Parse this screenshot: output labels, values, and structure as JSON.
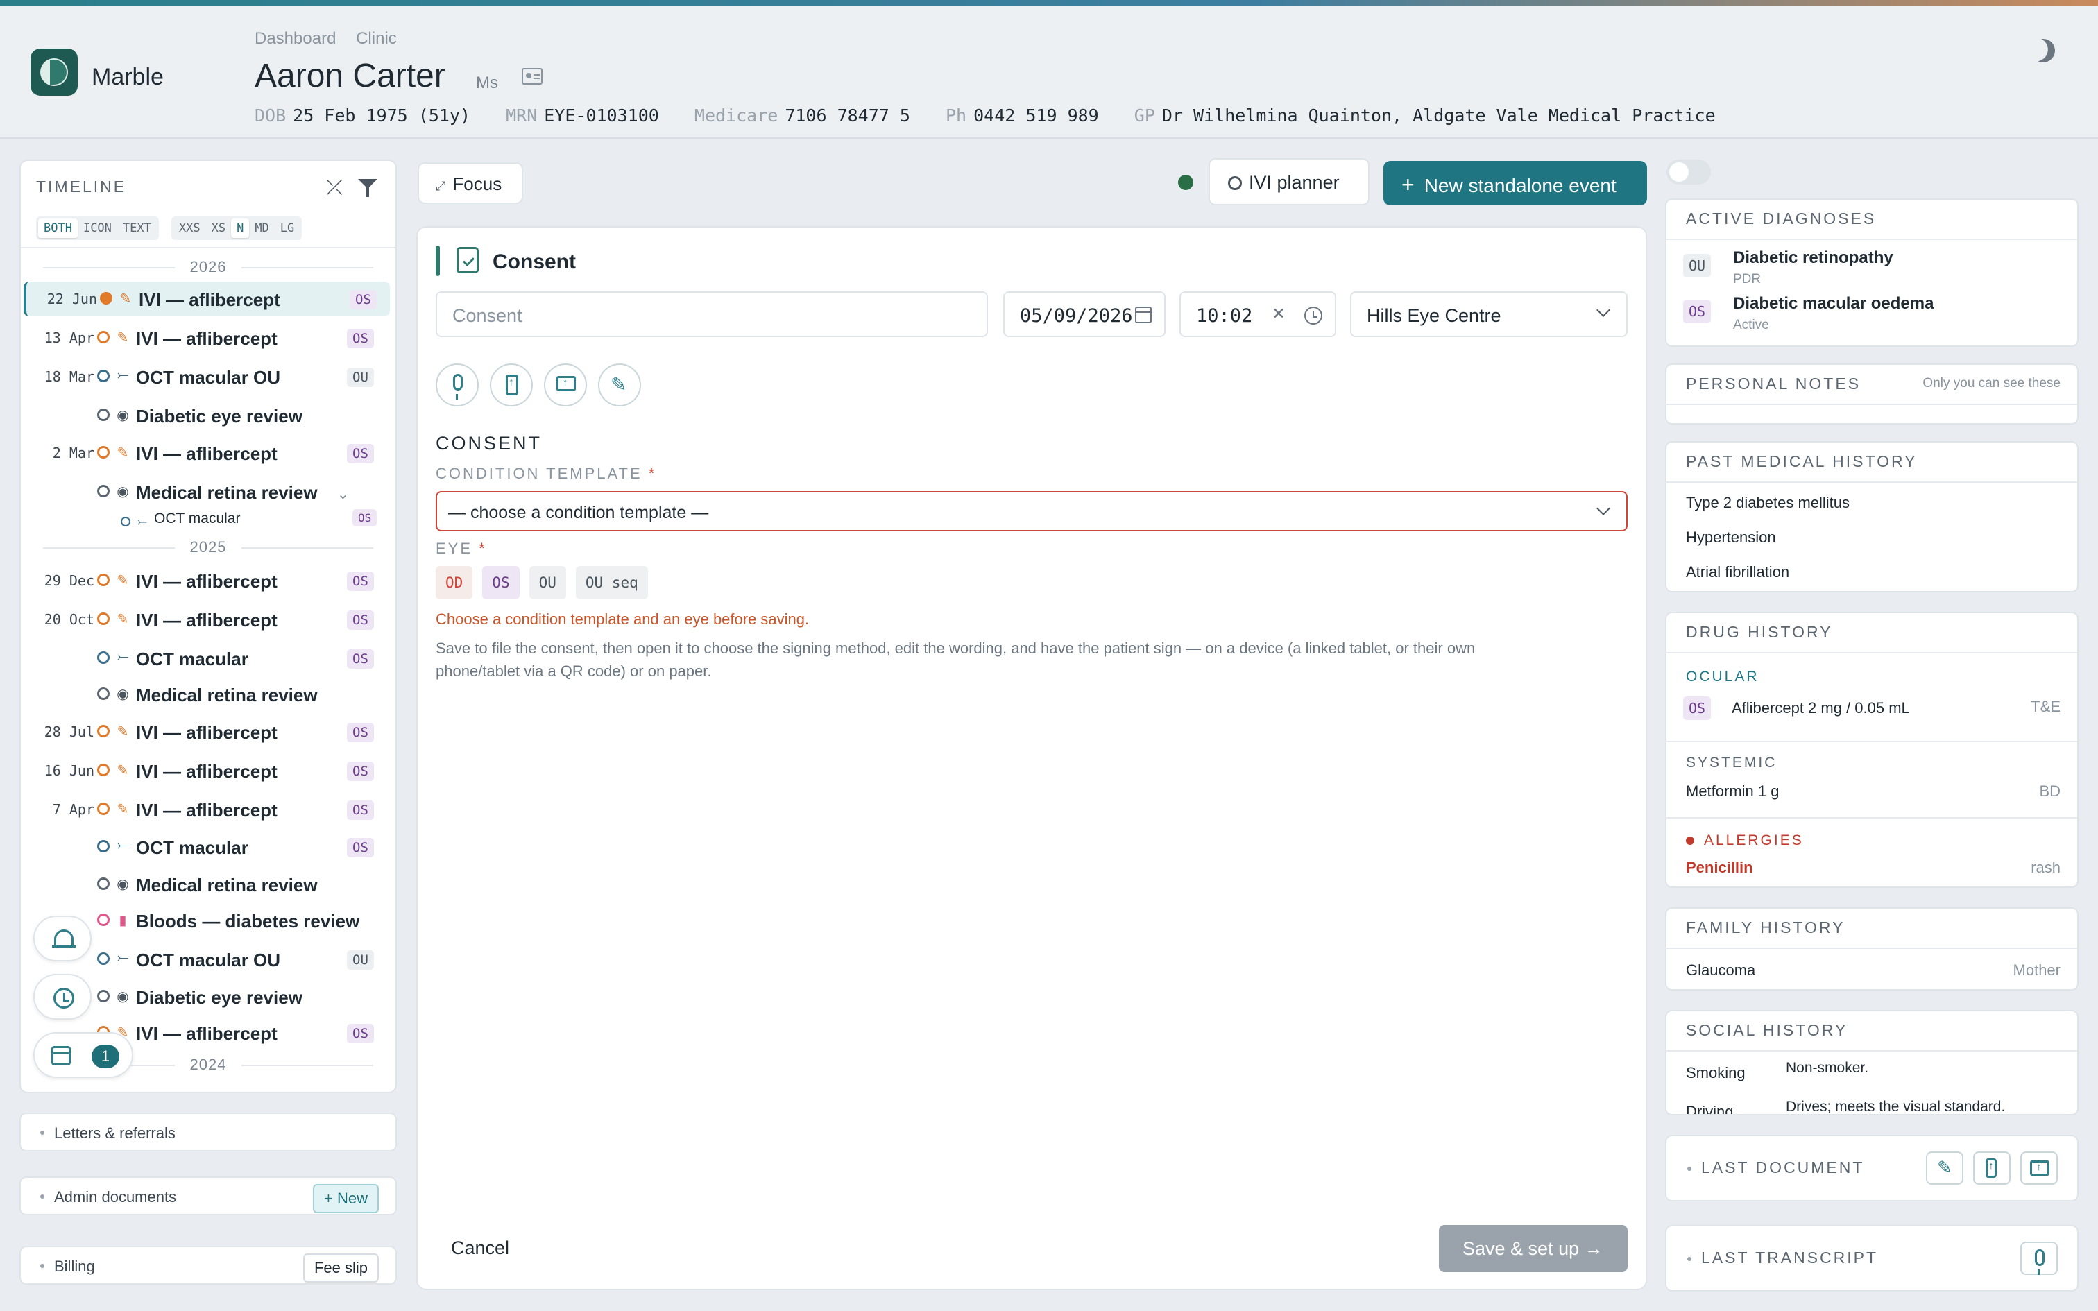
{
  "app": {
    "brand": "Marble"
  },
  "breadcrumb": [
    "Dashboard",
    "Clinic"
  ],
  "patient": {
    "name": "Aaron Carter",
    "title": "Ms",
    "dob_label": "DOB",
    "dob": "25 Feb 1975 (51y)",
    "mrn_label": "MRN",
    "mrn": "EYE-0103100",
    "medicare_label": "Medicare",
    "medicare": "7106 78477 5",
    "ph_label": "Ph",
    "ph": "0442 519 989",
    "gp_label": "GP",
    "gp": "Dr Wilhelmina Quainton, Aldgate Vale Medical Practice"
  },
  "timeline": {
    "title": "TIMELINE",
    "view_modes": [
      "BOTH",
      "ICON",
      "TEXT"
    ],
    "sizes": [
      "XXS",
      "XS",
      "N",
      "MD",
      "LG"
    ],
    "years": [
      "2026",
      "2025",
      "2024"
    ],
    "items": [
      {
        "date": "22 Jun",
        "label": "IVI — aflibercept",
        "badge": "OS"
      },
      {
        "date": "13 Apr",
        "label": "IVI — aflibercept",
        "badge": "OS"
      },
      {
        "date": "18 Mar",
        "label": "OCT macular OU",
        "badge": "OU"
      },
      {
        "date": "",
        "label": "Diabetic eye review",
        "badge": ""
      },
      {
        "date": "2 Mar",
        "label": "IVI — aflibercept",
        "badge": "OS"
      },
      {
        "date": "",
        "label": "Medical retina review",
        "badge": ""
      },
      {
        "date": "",
        "label": "OCT macular",
        "badge": "OS"
      },
      {
        "date": "29 Dec",
        "label": "IVI — aflibercept",
        "badge": "OS"
      },
      {
        "date": "20 Oct",
        "label": "IVI — aflibercept",
        "badge": "OS"
      },
      {
        "date": "",
        "label": "OCT macular",
        "badge": "OS"
      },
      {
        "date": "",
        "label": "Medical retina review",
        "badge": ""
      },
      {
        "date": "28 Jul",
        "label": "IVI — aflibercept",
        "badge": "OS"
      },
      {
        "date": "16 Jun",
        "label": "IVI — aflibercept",
        "badge": "OS"
      },
      {
        "date": "7 Apr",
        "label": "IVI — aflibercept",
        "badge": "OS"
      },
      {
        "date": "",
        "label": "OCT macular",
        "badge": "OS"
      },
      {
        "date": "",
        "label": "Medical retina review",
        "badge": ""
      },
      {
        "date": "",
        "label": "Bloods — diabetes review",
        "badge": ""
      },
      {
        "date": "",
        "label": "OCT macular OU",
        "badge": "OU"
      },
      {
        "date": "",
        "label": "Diabetic eye review",
        "badge": ""
      },
      {
        "date": "",
        "label": "IVI — aflibercept",
        "badge": "OS"
      }
    ],
    "calendar_count": "1"
  },
  "sections": {
    "letters": "Letters & referrals",
    "admin": "Admin documents",
    "admin_new": "+ New",
    "billing": "Billing",
    "fee_slip": "Fee slip"
  },
  "toolbar": {
    "focus": "Focus",
    "ivi_planner": "IVI planner",
    "new_event": "New standalone event"
  },
  "form": {
    "heading": "Consent",
    "title_placeholder": "Consent",
    "date": "05/09/2026",
    "time": "10:02",
    "location": "Hills Eye Centre",
    "section_title": "CONSENT",
    "template_label": "CONDITION TEMPLATE",
    "template_placeholder": "— choose a condition template —",
    "eye_label": "EYE",
    "eye_options": [
      "OD",
      "OS",
      "OU",
      "OU seq"
    ],
    "required_mark": "*",
    "error": "Choose a condition template and an eye before saving.",
    "help": "Save to file the consent, then open it to choose the signing method, edit the wording, and have the patient sign — on a device (a linked tablet, or their own phone/tablet via a QR code) or on paper.",
    "cancel": "Cancel",
    "save": "Save & set up →"
  },
  "sidebar": {
    "diagnoses_title": "ACTIVE DIAGNOSES",
    "diagnoses": [
      {
        "eye": "OU",
        "name": "Diabetic retinopathy",
        "sub": "PDR"
      },
      {
        "eye": "OS",
        "name": "Diabetic macular oedema",
        "sub": "Active"
      }
    ],
    "notes_title": "PERSONAL NOTES",
    "notes_hint": "Only you can see these",
    "pmh_title": "PAST MEDICAL HISTORY",
    "pmh": [
      "Type 2 diabetes mellitus",
      "Hypertension",
      "Atrial fibrillation"
    ],
    "drug_title": "DRUG HISTORY",
    "ocular_label": "OCULAR",
    "ocular_eye": "OS",
    "ocular_drug": "Aflibercept 2 mg / 0.05 mL",
    "ocular_freq": "T&E",
    "systemic_label": "SYSTEMIC",
    "systemic_drug": "Metformin 1 g",
    "systemic_freq": "BD",
    "allergies_label": "ALLERGIES",
    "allergy": "Penicillin",
    "allergy_reaction": "rash",
    "family_title": "FAMILY HISTORY",
    "family_condition": "Glaucoma",
    "family_relation": "Mother",
    "social_title": "SOCIAL HISTORY",
    "social": [
      {
        "key": "Smoking",
        "value": "Non-smoker."
      },
      {
        "key": "Driving",
        "value": "Drives; meets the visual standard."
      }
    ],
    "last_document": "LAST DOCUMENT",
    "last_transcript": "LAST TRANSCRIPT"
  },
  "colors": {
    "accent": "#1f7682",
    "brand": "#1e5a52",
    "error": "#d0453a",
    "os": "#6b3d8a",
    "ivi": "#e07b2c"
  }
}
